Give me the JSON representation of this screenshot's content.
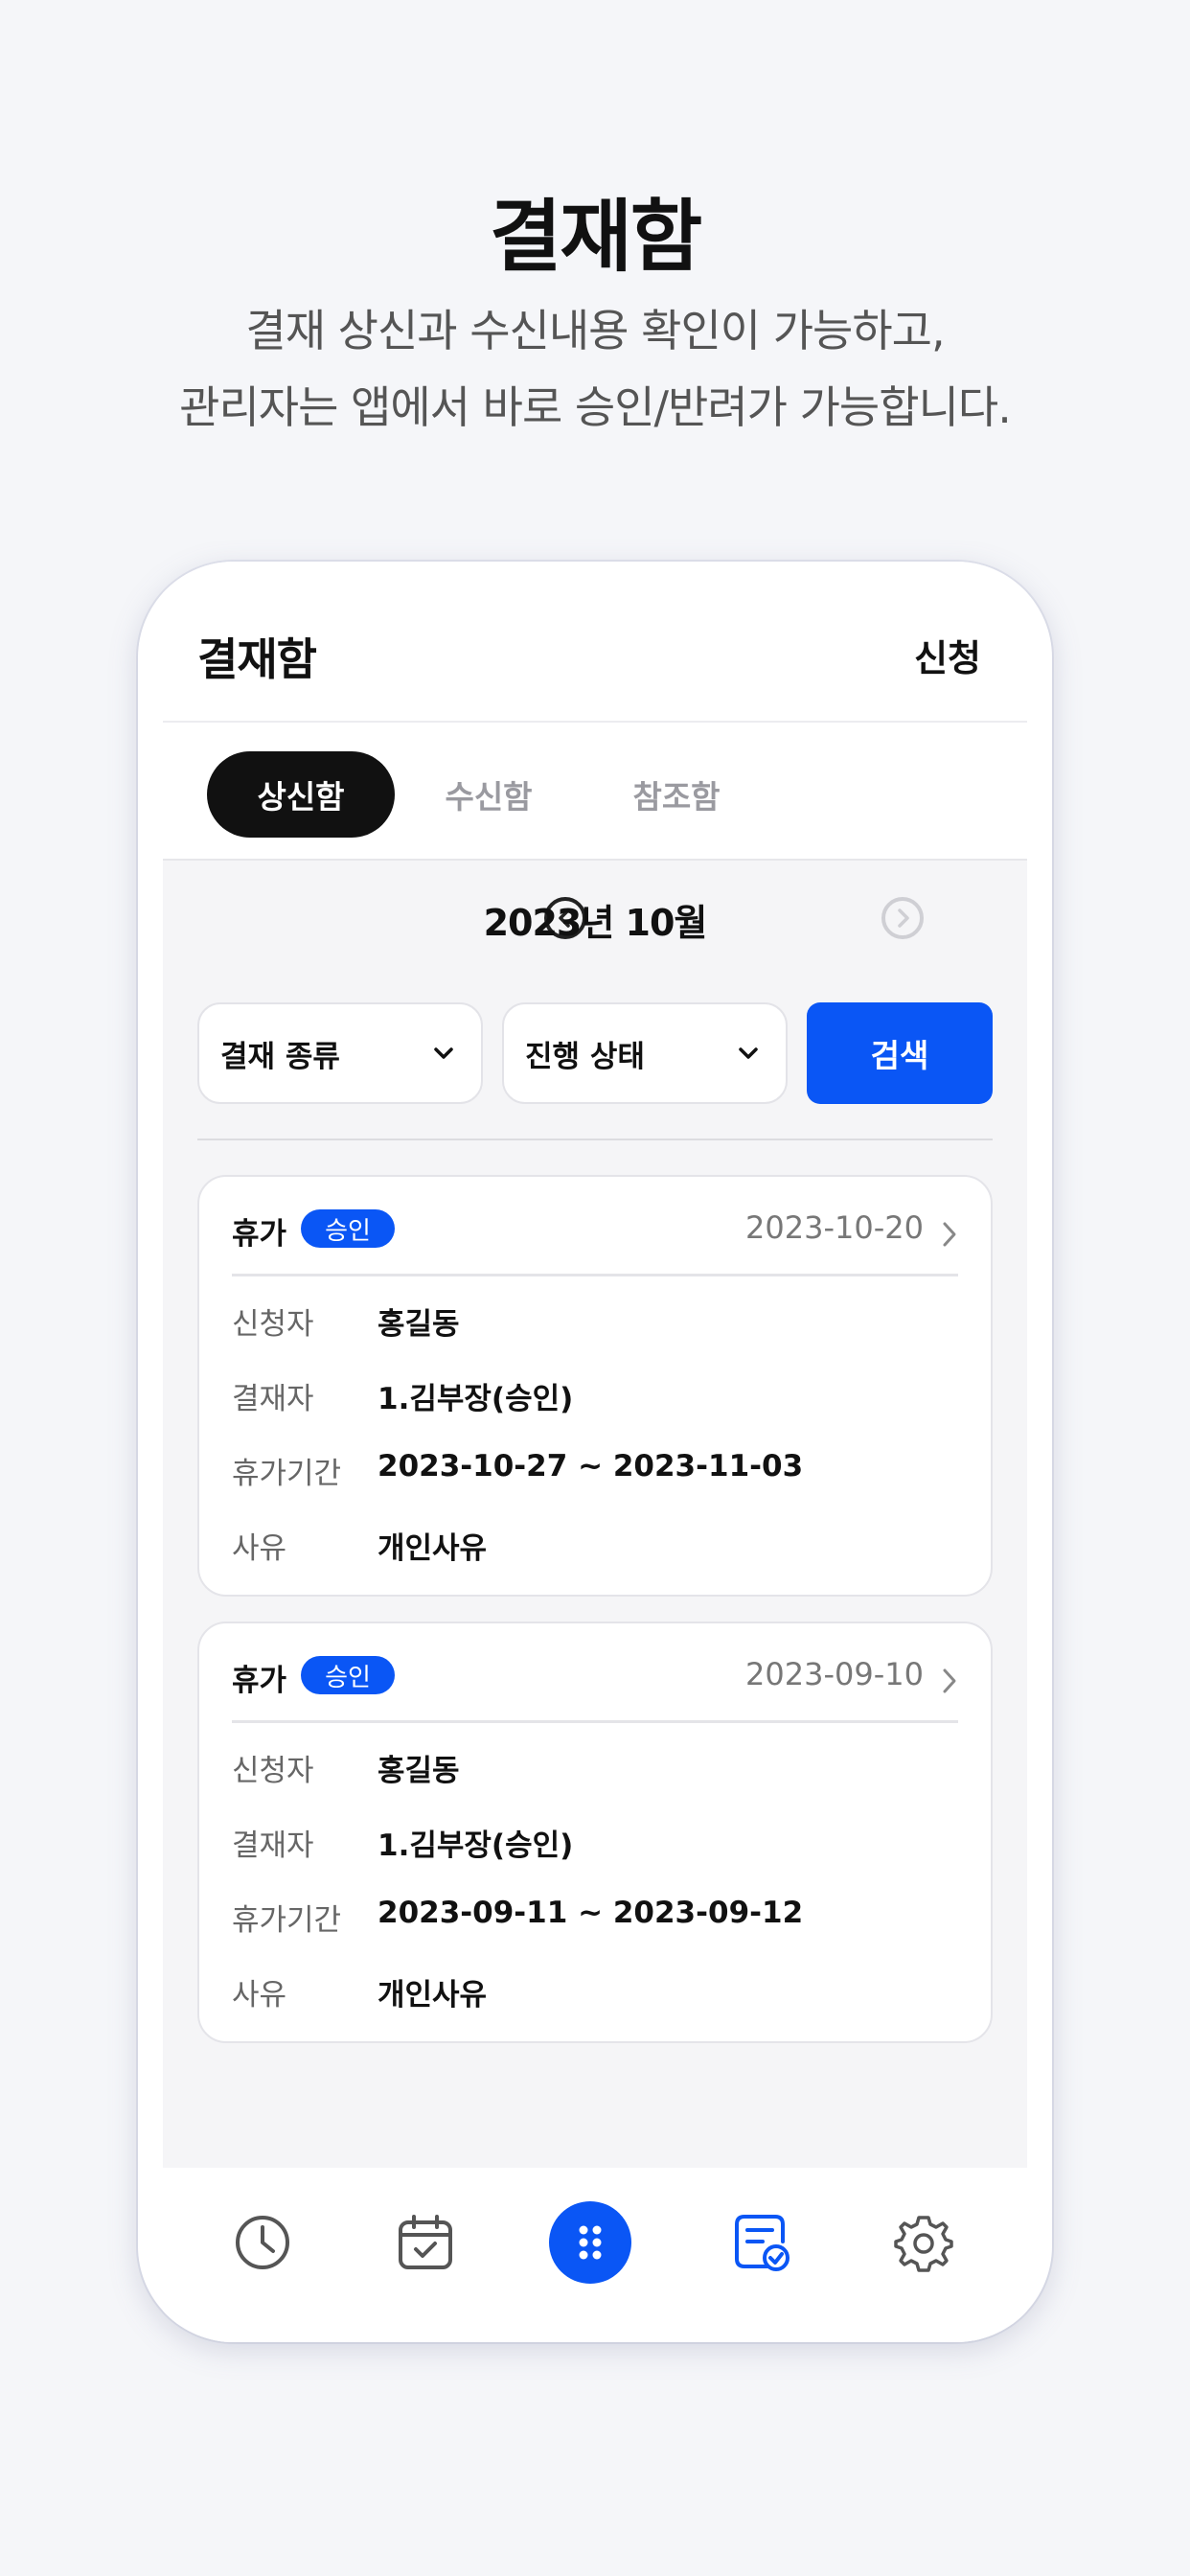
{
  "hero": {
    "title": "결재함",
    "subtitle_line1": "결재 상신과 수신내용 확인이 가능하고,",
    "subtitle_line2": "관리자는 앱에서 바로 승인/반려가 가능합니다."
  },
  "appbar": {
    "title": "결재함",
    "action_label": "신청"
  },
  "tabs": [
    {
      "label": "상신함",
      "active": true
    },
    {
      "label": "수신함",
      "active": false
    },
    {
      "label": "참조함",
      "active": false
    }
  ],
  "month": {
    "label": "2023년 10월",
    "prev_icon": "chevron-left-circle-icon",
    "next_icon": "chevron-right-circle-icon"
  },
  "filters": {
    "type_select": "결재 종류",
    "status_select": "진행 상태",
    "search_label": "검색"
  },
  "cards": [
    {
      "type": "휴가",
      "badge": "승인",
      "date": "2023-10-20",
      "rows": [
        {
          "key": "신청자",
          "value": "홍길동"
        },
        {
          "key": "결재자",
          "value": "1.김부장(승인)"
        },
        {
          "key": "휴가기간",
          "value": "2023-10-27 ~ 2023-11-03"
        },
        {
          "key": "사유",
          "value": "개인사유"
        }
      ]
    },
    {
      "type": "휴가",
      "badge": "승인",
      "date": "2023-09-10",
      "rows": [
        {
          "key": "신청자",
          "value": "홍길동"
        },
        {
          "key": "결재자",
          "value": "1.김부장(승인)"
        },
        {
          "key": "휴가기간",
          "value": "2023-09-11 ~ 2023-09-12"
        },
        {
          "key": "사유",
          "value": "개인사유"
        }
      ]
    }
  ],
  "bottom_nav": {
    "items": [
      "clock-icon",
      "calendar-check-icon",
      "apps-grid-icon",
      "approval-doc-icon",
      "settings-gear-icon"
    ],
    "active_index": 3
  },
  "colors": {
    "accent": "#0a56f5",
    "background": "#f5f6f9",
    "text": "#111111"
  }
}
